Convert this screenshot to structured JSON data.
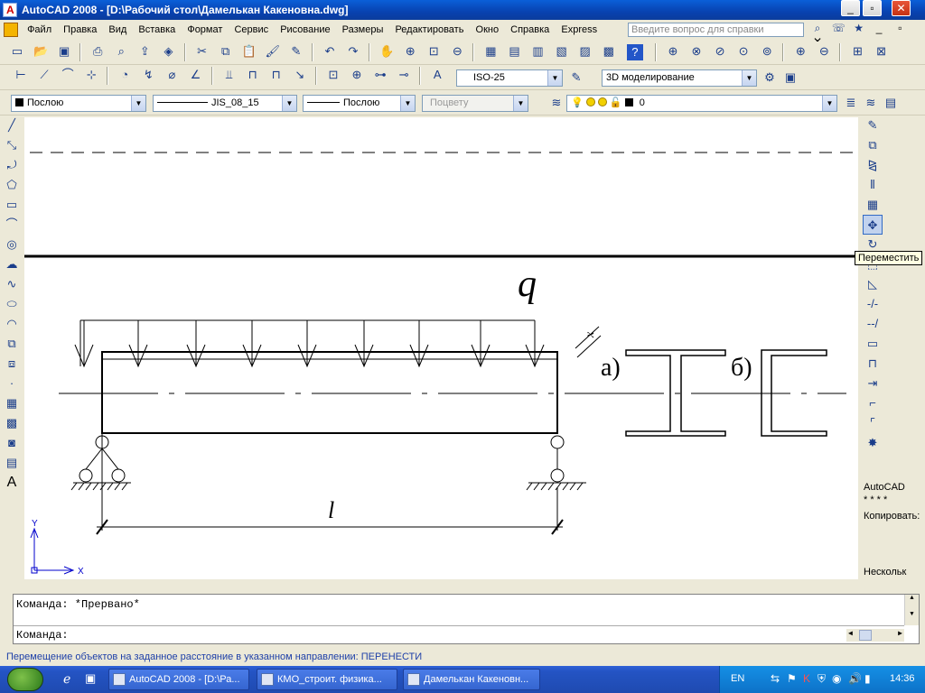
{
  "window": {
    "title": "AutoCAD 2008 - [D:\\Рабочий стол\\Дамелькан Какеновна.dwg]",
    "controls": [
      "_",
      "▫",
      "✕"
    ]
  },
  "menu": {
    "items": [
      "Файл",
      "Правка",
      "Вид",
      "Вставка",
      "Формат",
      "Сервис",
      "Рисование",
      "Размеры",
      "Редактировать",
      "Окно",
      "Справка",
      "Express"
    ],
    "help_placeholder": "Введите вопрос для справки"
  },
  "toolbar2": {
    "dimstyle": "ISO-25",
    "workspace": "3D моделирование"
  },
  "properties": {
    "color": "Послою",
    "linetype": "JIS_08_15",
    "lineweight": "Послою",
    "plotstyle": "Поцвету",
    "layer": "0"
  },
  "drawing": {
    "load_label": "q",
    "span_label": "l",
    "section_a": "а)",
    "section_b": "б)",
    "axis_label": "x",
    "ucs_x": "X",
    "ucs_y": "Y"
  },
  "tooltip": "Переместить",
  "right_panel": {
    "line1": "AutoCAD",
    "line2": "* * * *",
    "line3": "Копировать:",
    "line4": "Нескольк"
  },
  "command": {
    "history": "Команда: *Прервано*",
    "prompt": "Команда:"
  },
  "status_text": "Перемещение объектов на заданное расстояние в указанном направлении:  ПЕРЕНЕСТИ",
  "taskbar": {
    "tasks": [
      "AutoCAD 2008 - [D:\\Ра...",
      "КМО_строит. физика...",
      "Дамелькан Какеновн..."
    ],
    "lang": "EN",
    "clock": "14:36"
  },
  "colors": {
    "titlebar": "#0a5fd8",
    "canvas": "#ffffff",
    "status_text": "#1d3fa8",
    "taskbar": "#2454c4"
  }
}
